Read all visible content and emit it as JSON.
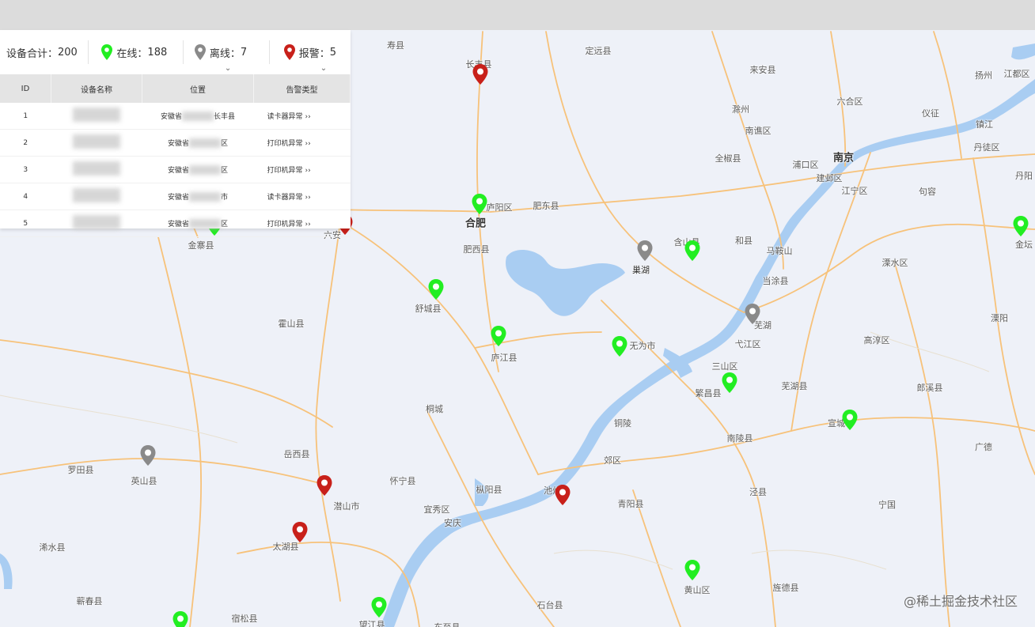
{
  "summary": {
    "total_label": "设备合计：",
    "total_value": "200",
    "online_label": "在线：",
    "online_value": "188",
    "offline_label": "离线：",
    "offline_value": "7",
    "alarm_label": "报警：",
    "alarm_value": "5",
    "chevron": "⌄"
  },
  "colors": {
    "online": "#22ee22",
    "offline": "#8a8a8a",
    "alarm": "#c8201a",
    "road": "#f7c27a",
    "water": "#a9cdf2"
  },
  "table": {
    "headers": [
      "ID",
      "设备名称",
      "位置",
      "告警类型"
    ],
    "rows": [
      {
        "id": "1",
        "loc_prefix": "安徽省",
        "loc_suffix": "长丰县",
        "type": "读卡器异常",
        "arrow": "››"
      },
      {
        "id": "2",
        "loc_prefix": "安徽省",
        "loc_suffix": "区",
        "type": "打印机异常",
        "arrow": "››"
      },
      {
        "id": "3",
        "loc_prefix": "安徽省",
        "loc_suffix": "区",
        "type": "打印机异常",
        "arrow": "››"
      },
      {
        "id": "4",
        "loc_prefix": "安徽省",
        "loc_suffix": "市",
        "type": "读卡器异常",
        "arrow": "››"
      },
      {
        "id": "5",
        "loc_prefix": "安徽省",
        "loc_suffix": "区",
        "type": "打印机异常",
        "arrow": "››"
      }
    ]
  },
  "places": [
    {
      "name": "寿县",
      "cls": ""
    },
    {
      "name": "定远县",
      "cls": ""
    },
    {
      "name": "来安县",
      "cls": ""
    },
    {
      "name": "扬州",
      "cls": ""
    },
    {
      "name": "江都区",
      "cls": ""
    },
    {
      "name": "长丰县",
      "cls": ""
    },
    {
      "name": "六合区",
      "cls": ""
    },
    {
      "name": "仪征",
      "cls": ""
    },
    {
      "name": "滁州",
      "cls": ""
    },
    {
      "name": "镇江",
      "cls": ""
    },
    {
      "name": "南谯区",
      "cls": ""
    },
    {
      "name": "丹徒区",
      "cls": ""
    },
    {
      "name": "南京",
      "cls": "big"
    },
    {
      "name": "全椒县",
      "cls": ""
    },
    {
      "name": "浦口区",
      "cls": ""
    },
    {
      "name": "建邺区",
      "cls": ""
    },
    {
      "name": "江宁区",
      "cls": ""
    },
    {
      "name": "句容",
      "cls": ""
    },
    {
      "name": "丹阳",
      "cls": ""
    },
    {
      "name": "庐阳区",
      "cls": ""
    },
    {
      "name": "肥东县",
      "cls": ""
    },
    {
      "name": "合肥",
      "cls": "big"
    },
    {
      "name": "六安",
      "cls": ""
    },
    {
      "name": "金寨县",
      "cls": ""
    },
    {
      "name": "含山县",
      "cls": ""
    },
    {
      "name": "和县",
      "cls": ""
    },
    {
      "name": "马鞍山",
      "cls": ""
    },
    {
      "name": "金坛",
      "cls": ""
    },
    {
      "name": "肥西县",
      "cls": ""
    },
    {
      "name": "巢湖",
      "cls": "mid"
    },
    {
      "name": "溧水区",
      "cls": ""
    },
    {
      "name": "当涂县",
      "cls": ""
    },
    {
      "name": "舒城县",
      "cls": ""
    },
    {
      "name": "霍山县",
      "cls": ""
    },
    {
      "name": "芜湖",
      "cls": ""
    },
    {
      "name": "溧阳",
      "cls": ""
    },
    {
      "name": "弋江区",
      "cls": ""
    },
    {
      "name": "无为市",
      "cls": ""
    },
    {
      "name": "高淳区",
      "cls": ""
    },
    {
      "name": "庐江县",
      "cls": ""
    },
    {
      "name": "三山区",
      "cls": ""
    },
    {
      "name": "芜湖县",
      "cls": ""
    },
    {
      "name": "繁昌县",
      "cls": ""
    },
    {
      "name": "郎溪县",
      "cls": ""
    },
    {
      "name": "桐城",
      "cls": ""
    },
    {
      "name": "铜陵",
      "cls": ""
    },
    {
      "name": "宣城",
      "cls": ""
    },
    {
      "name": "南陵县",
      "cls": ""
    },
    {
      "name": "广德",
      "cls": ""
    },
    {
      "name": "罗田县",
      "cls": ""
    },
    {
      "name": "岳西县",
      "cls": ""
    },
    {
      "name": "郊区",
      "cls": ""
    },
    {
      "name": "英山县",
      "cls": ""
    },
    {
      "name": "怀宁县",
      "cls": ""
    },
    {
      "name": "泾县",
      "cls": ""
    },
    {
      "name": "潜山市",
      "cls": ""
    },
    {
      "name": "枞阳县",
      "cls": ""
    },
    {
      "name": "池州",
      "cls": ""
    },
    {
      "name": "青阳县",
      "cls": ""
    },
    {
      "name": "宁国",
      "cls": ""
    },
    {
      "name": "宜秀区",
      "cls": ""
    },
    {
      "name": "安庆",
      "cls": ""
    },
    {
      "name": "浠水县",
      "cls": ""
    },
    {
      "name": "太湖县",
      "cls": ""
    },
    {
      "name": "黄山区",
      "cls": ""
    },
    {
      "name": "旌德县",
      "cls": ""
    },
    {
      "name": "蕲春县",
      "cls": ""
    },
    {
      "name": "宿松县",
      "cls": ""
    },
    {
      "name": "石台县",
      "cls": ""
    },
    {
      "name": "望江县",
      "cls": ""
    },
    {
      "name": "东至县",
      "cls": ""
    }
  ],
  "markers": [
    "alarm",
    "online",
    "alarm",
    "online",
    "online",
    "offline",
    "online",
    "online",
    "offline",
    "online",
    "online",
    "online",
    "alarm",
    "offline",
    "alarm",
    "alarm",
    "online",
    "online",
    "online",
    "online"
  ],
  "watermark": "@稀土掘金技术社区"
}
